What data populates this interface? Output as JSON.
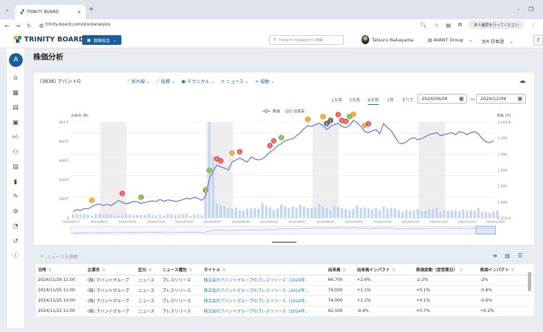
{
  "browser": {
    "tab_title": "TRINITY BOARD",
    "url": "trinity-board.com/stockanalysis",
    "profile_pill": "本人確認を行ってください"
  },
  "app": {
    "logo": "TRINITY BOARD",
    "primary_button": "取締役会",
    "search_placeholder": "TRINITY BOARDから検索",
    "user_name": "Tatsuru Nakayama",
    "company": "AVANT Group",
    "language": "日本語",
    "help": "?"
  },
  "sidebar": {
    "avatar_letter": "A",
    "icons": [
      "home-icon",
      "dashboard-icon",
      "calendar-icon",
      "calendar-alt-icon",
      "thumbs-up-icon",
      "people-icon",
      "document-icon",
      "bar-chart-icon",
      "document-edit-icon",
      "people-gear-icon",
      "pie-chart-icon",
      "history-icon",
      "info-icon"
    ]
  },
  "page": {
    "title": "株価分析"
  },
  "stock_card": {
    "title": "(3836) アバントG",
    "toolbar": [
      "折れ線",
      "指標",
      "テクニカル",
      "ニュース",
      "指数"
    ],
    "ranges": [
      "1カ月",
      "3カ月",
      "6カ月",
      "1年",
      "すべて"
    ],
    "active_range": "6カ月",
    "date_from": "2024/06/09",
    "date_to": "2024/12/09",
    "date_sep": "〜"
  },
  "chart_data": {
    "type": "line",
    "legend": [
      "株価",
      "出来高"
    ],
    "legend_position": "top-center",
    "left_axis_title": "出来高 (株)",
    "right_axis_title": "株価 (円)",
    "left_ticks": [
      "901千",
      "800千",
      "600千",
      "400千",
      "200千",
      "0"
    ],
    "right_ticks": [
      "2,163.8",
      "2,200",
      "2,000",
      "1,800",
      "1,600",
      "1,400",
      "1,214.9"
    ],
    "x_ticks": [
      "2024/06/11",
      "2024/06/21",
      "2024/07/01",
      "2024/07/16",
      "2024/07/26",
      "2024/08/07",
      "2024/08/20",
      "2024/08/30",
      "2024/09/11",
      "2024/09/25",
      "2024/10/07",
      "2024/10/18",
      "2024/10/30",
      "2024/11/12",
      "2024/11/22",
      "2024/12/04"
    ],
    "grid": true,
    "shaded_bands": true,
    "price": [
      1280,
      1300,
      1290,
      1310,
      1305,
      1330,
      1345,
      1355,
      1340,
      1350,
      1340,
      1360,
      1390,
      1370,
      1355,
      1365,
      1380,
      1375,
      1360,
      1370,
      1380,
      1385,
      1380,
      1400,
      1380,
      1395,
      1390,
      1380,
      1385,
      1400,
      1410,
      1405,
      1420,
      1410,
      1390,
      1430,
      1600,
      1680,
      1740,
      1720,
      1710,
      1690,
      1770,
      1790,
      1810,
      1790,
      1770,
      1820,
      1800,
      1790,
      1800,
      1830,
      1870,
      1890,
      1930,
      1950,
      1980,
      1990,
      2000,
      2030,
      2060,
      2100,
      2130,
      2120,
      2140,
      2150,
      2130,
      2090,
      2120,
      2140,
      2150,
      2120,
      2110,
      2130,
      2180,
      2160,
      2120,
      2070,
      2060,
      2080,
      2090,
      2050,
      2150,
      2110,
      2080,
      2020,
      1960,
      1950,
      1970,
      2000,
      2010,
      1990,
      2000,
      2020,
      2040,
      2050,
      2060,
      2030,
      2040,
      2050,
      2060,
      2040,
      2070,
      2060,
      2040,
      2060,
      2070,
      2050,
      2000,
      1970,
      1960,
      1980
    ],
    "volume": [
      40,
      40,
      35,
      40,
      30,
      25,
      40,
      45,
      30,
      35,
      35,
      25,
      25,
      30,
      40,
      35,
      30,
      30,
      30,
      30,
      40,
      30,
      25,
      30,
      25,
      40,
      35,
      30,
      30,
      35,
      40,
      20,
      30,
      35,
      25,
      300,
      901,
      580,
      140,
      120,
      110,
      95,
      90,
      100,
      75,
      70,
      90,
      95,
      95,
      85,
      140,
      120,
      100,
      75,
      90,
      130,
      110,
      95,
      110,
      95,
      125,
      110,
      95,
      90,
      100,
      135,
      110,
      95,
      75,
      115,
      105,
      95,
      85,
      75,
      85,
      120,
      95,
      100,
      90,
      80,
      95,
      75,
      110,
      90,
      95,
      90,
      75,
      60,
      80,
      70,
      75,
      85,
      65,
      70,
      85,
      80,
      95,
      60,
      75,
      70,
      70,
      75,
      65,
      80,
      70,
      75,
      70,
      95,
      60,
      55,
      50,
      60,
      70
    ],
    "news_markers": [
      {
        "i": 5,
        "label": "1",
        "type": "orange"
      },
      {
        "i": 13,
        "label": "1",
        "type": "red"
      },
      {
        "i": 18,
        "label": "1",
        "type": "green"
      },
      {
        "i": 35,
        "label": "1",
        "type": "green"
      },
      {
        "i": 36,
        "label": "1",
        "type": "green"
      },
      {
        "i": 38,
        "label": "1",
        "type": "red"
      },
      {
        "i": 39,
        "label": "1",
        "type": "red"
      },
      {
        "i": 42,
        "label": "1",
        "type": "orange"
      },
      {
        "i": 44,
        "label": "1",
        "type": "red"
      },
      {
        "i": 52,
        "label": "1",
        "type": "red"
      },
      {
        "i": 53,
        "label": "1",
        "type": "red"
      },
      {
        "i": 55,
        "label": "2",
        "type": "green"
      },
      {
        "i": 62,
        "label": "1",
        "type": "orange"
      },
      {
        "i": 66,
        "label": "1",
        "type": "orange"
      },
      {
        "i": 67,
        "label": "1",
        "type": "gray"
      },
      {
        "i": 68,
        "label": "1",
        "type": "gray"
      },
      {
        "i": 70,
        "label": "1",
        "type": "red"
      },
      {
        "i": 71,
        "label": "3",
        "type": "red"
      },
      {
        "i": 72,
        "label": "1",
        "type": "red"
      },
      {
        "i": 73,
        "label": "1",
        "type": "green"
      },
      {
        "i": 74,
        "label": "1",
        "type": "orange"
      },
      {
        "i": 77,
        "label": "1",
        "type": "orange"
      },
      {
        "i": 78,
        "label": "1",
        "type": "red"
      }
    ],
    "price_range": [
      1214.9,
      2163.8
    ],
    "volume_range": [
      0,
      901
    ]
  },
  "news": {
    "search_placeholder": "ニュースを検索",
    "columns": [
      "日時",
      "企業名",
      "区分",
      "ニュース種別",
      "タイトル",
      "出来高",
      "出来高インパクト",
      "株価変動（翌営業日）",
      "株価インパクト"
    ],
    "rows": [
      [
        "2024/11/29 11:00",
        "(株) アバントグループ",
        "ニュース",
        "プレスリリース",
        "株式会社アバントグループのプレスリリース（2024年...",
        "66,700",
        "+2.6%",
        "-2.2%",
        "-2%"
      ],
      [
        "2024/11/25 11:00",
        "(株) アバントグループ",
        "ニュース",
        "プレスリリース",
        "株式会社アバントグループのプレスリリース（2024年...",
        "74,000",
        "+1.1%",
        "+0.1%",
        "-0.6%"
      ],
      [
        "2024/11/25 10:00",
        "(株) アバントグループ",
        "ニュース",
        "プレスリリース",
        "株式会社アバントグループのプレスリリース（2024年...",
        "74,000",
        "+1.1%",
        "+0.1%",
        "-0.6%"
      ],
      [
        "2024/11/22 11:00",
        "(株) アバントグループ",
        "ニュース",
        "プレスリリース",
        "株式会社アバントグループのプレスリリース（2024年...",
        "62,500",
        "-9.4%",
        "+0.7%",
        "+0.2%"
      ]
    ]
  },
  "colors": {
    "brand_blue": "#1b5c9e",
    "price_line": "#5b6fd6",
    "volume_bar": "#c2d4f5",
    "band": "#eeeeee",
    "marker_orange": "#f0a030",
    "marker_red": "#e05a5a",
    "marker_green": "#7ab648",
    "marker_gray": "#666666",
    "link": "#1b7ea8"
  }
}
